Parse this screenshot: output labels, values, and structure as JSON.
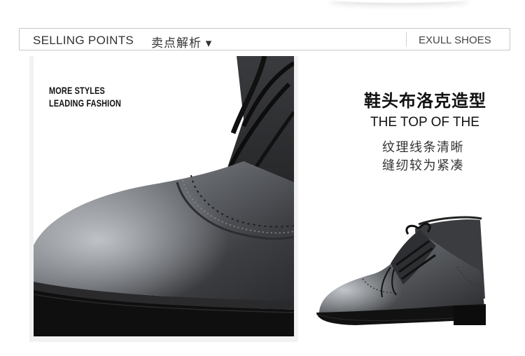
{
  "header": {
    "title_en": "SELLING POINTS",
    "title_cn": "卖点解析 ▾",
    "brand": "EXULL SHOES"
  },
  "promo": {
    "line1": "MORE STYLES",
    "line2": "LEADING FASHION"
  },
  "feature": {
    "title_cn": "鞋头布洛克造型",
    "title_en": "THE TOP OF THE",
    "desc_line1": "纹理线条清晰",
    "desc_line2": "缝纫较为紧凑"
  },
  "colors": {
    "header_border": "#c9c9c9",
    "leather": "#5a5d61",
    "sole": "#0f0f0f"
  }
}
